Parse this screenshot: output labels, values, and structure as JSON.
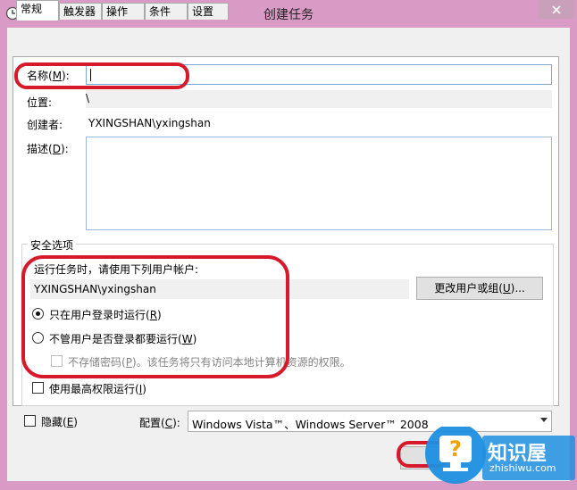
{
  "window": {
    "title": "创建任务"
  },
  "tabs": [
    {
      "label": "常规"
    },
    {
      "label": "触发器"
    },
    {
      "label": "操作"
    },
    {
      "label": "条件"
    },
    {
      "label": "设置"
    }
  ],
  "general": {
    "name_label": "名称(",
    "name_key": "M",
    "name_label_end": "):",
    "name_value": "",
    "location_label": "位置:",
    "location_value": "\\",
    "author_label": "创建者:",
    "author_value": "YXINGSHAN\\yxingshan",
    "description_label": "描述(",
    "description_key": "D",
    "description_label_end": "):",
    "description_value": ""
  },
  "security": {
    "group_title": "安全选项",
    "run_as_label": "运行任务时，请使用下列用户帐户:",
    "user_account": "YXINGSHAN\\yxingshan",
    "change_user_button": "更改用户或组(",
    "change_user_key": "U",
    "change_user_end": ")...",
    "option_logged_on": "只在用户登录时运行(",
    "option_logged_on_key": "R",
    "option_whether": "不管用户是否登录都要运行(",
    "option_whether_key": "W",
    "no_store_password": "不存储密码(",
    "no_store_password_key": "P",
    "no_store_password_end": ")。该任务将只有访问本地计算机资源的权限。",
    "highest_privileges": "使用最高权限运行(",
    "highest_privileges_key": "I"
  },
  "bottom": {
    "hidden_label": "隐藏(",
    "hidden_key": "E",
    "config_label": "配置(",
    "config_key": "C",
    "config_value": "Windows Vista™、Windows Server™ 2008"
  },
  "watermark": {
    "brand": "知识屋",
    "url": "zhishiwu.com"
  },
  "colors": {
    "frame": "#d99ac5",
    "annotation": "#d61a2b",
    "watermark_blue": "#1e8fe0"
  }
}
